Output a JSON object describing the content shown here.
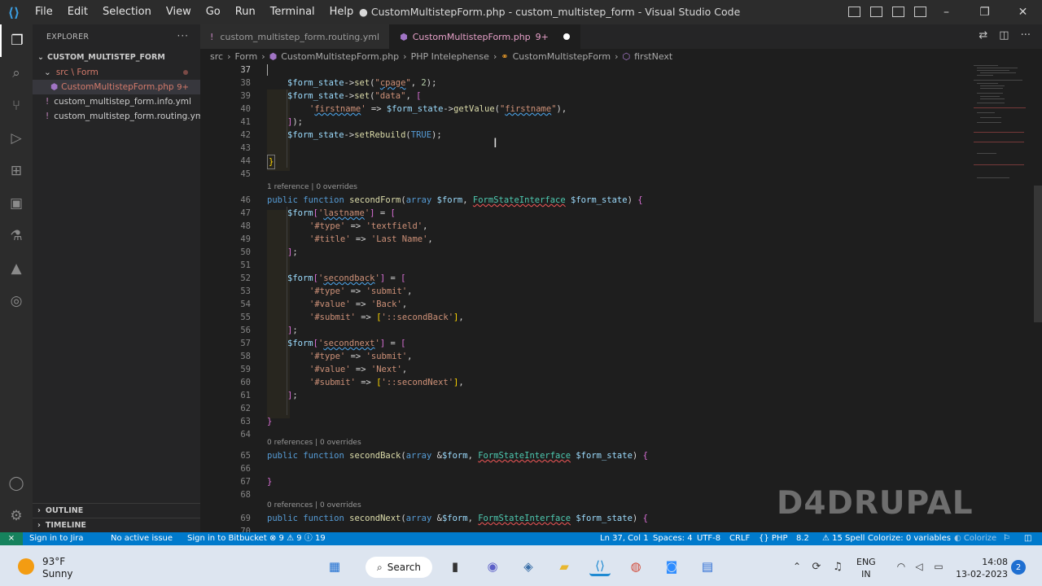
{
  "window": {
    "title": "● CustomMultistepForm.php - custom_multistep_form - Visual Studio Code",
    "menu": [
      "File",
      "Edit",
      "Selection",
      "View",
      "Go",
      "Run",
      "Terminal",
      "Help"
    ],
    "controls": [
      "–",
      "❐",
      "✕"
    ]
  },
  "explorer": {
    "header": "EXPLORER",
    "more": "···",
    "root": "CUSTOM_MULTISTEP_FORM",
    "items": [
      {
        "label": "src \\ Form",
        "badge": ""
      },
      {
        "label": "CustomMultistepForm.php",
        "badge": "9+"
      },
      {
        "label": "custom_multistep_form.info.yml",
        "badge": ""
      },
      {
        "label": "custom_multistep_form.routing.yml",
        "badge": ""
      }
    ],
    "outline": "OUTLINE",
    "timeline": "TIMELINE"
  },
  "tabs": [
    {
      "label": "custom_multistep_form.routing.yml",
      "badge": ""
    },
    {
      "label": "CustomMultistepForm.php",
      "badge": "9+"
    }
  ],
  "breadcrumb": [
    "src",
    "›",
    "Form",
    "›",
    "CustomMultistepForm.php",
    "›",
    "PHP Intelephense",
    "›",
    "CustomMultistepForm",
    "›",
    "firstNext"
  ],
  "code": {
    "lines": [
      {
        "n": "37",
        "t": ""
      },
      {
        "n": "38",
        "t": "$form_state->set(\"cpage\", 2);"
      },
      {
        "n": "39",
        "t": "$form_state->set(\"data\", ["
      },
      {
        "n": "40",
        "t": "'firstname' => $form_state->getValue(\"firstname\"),"
      },
      {
        "n": "41",
        "t": "]);"
      },
      {
        "n": "42",
        "t": "$form_state->setRebuild(TRUE);"
      },
      {
        "n": "43",
        "t": ""
      },
      {
        "n": "44",
        "t": "}"
      },
      {
        "n": "45",
        "t": ""
      },
      {
        "n": "46",
        "t": "public function secondForm(array $form, FormStateInterface $form_state) {"
      },
      {
        "n": "47",
        "t": "$form['lastname'] = ["
      },
      {
        "n": "48",
        "t": "'#type' => 'textfield',"
      },
      {
        "n": "49",
        "t": "'#title' => 'Last Name',"
      },
      {
        "n": "50",
        "t": "];"
      },
      {
        "n": "51",
        "t": ""
      },
      {
        "n": "52",
        "t": "$form['secondback'] = ["
      },
      {
        "n": "53",
        "t": "'#type' => 'submit',"
      },
      {
        "n": "54",
        "t": "'#value' => 'Back',"
      },
      {
        "n": "55",
        "t": "'#submit' => ['::secondBack'],"
      },
      {
        "n": "56",
        "t": "];"
      },
      {
        "n": "57",
        "t": "$form['secondnext'] = ["
      },
      {
        "n": "58",
        "t": "'#type' => 'submit',"
      },
      {
        "n": "59",
        "t": "'#value' => 'Next',"
      },
      {
        "n": "60",
        "t": "'#submit' => ['::secondNext'],"
      },
      {
        "n": "61",
        "t": "];"
      },
      {
        "n": "62",
        "t": ""
      },
      {
        "n": "63",
        "t": "}"
      },
      {
        "n": "64",
        "t": ""
      },
      {
        "n": "65",
        "t": "public function secondBack(array &$form, FormStateInterface $form_state) {"
      },
      {
        "n": "66",
        "t": ""
      },
      {
        "n": "67",
        "t": "}"
      },
      {
        "n": "68",
        "t": ""
      },
      {
        "n": "69",
        "t": "public function secondNext(array &$form, FormStateInterface $form_state) {"
      },
      {
        "n": "70",
        "t": ""
      }
    ],
    "lens": [
      "1 reference | 0 overrides",
      "0 references | 0 overrides",
      "0 references | 0 overrides"
    ]
  },
  "watermark": "D4DRUPAL",
  "status": {
    "remote": "⨯",
    "jira": "Sign in to Jira",
    "issue": "No active issue",
    "bitbucket": "Sign in to Bitbucket",
    "problems": "⊗ 9 ⚠ 9 ⓘ 19",
    "position": "Ln 37, Col 1",
    "spaces": "Spaces: 4",
    "encoding": "UTF-8",
    "eol": "CRLF",
    "language": "PHP",
    "version": "8.2",
    "spell": "15 Spell",
    "colorize": "Colorize: 0 variables",
    "colorize2": "Colorize"
  },
  "taskbar": {
    "temp": "93°F",
    "condition": "Sunny",
    "search": "Search",
    "lang1": "ENG",
    "lang2": "IN",
    "time": "14:08",
    "date": "13-02-2023",
    "notifications": "2"
  },
  "colors": {
    "accent": "#007acc",
    "modified": "#e6a0c8",
    "error": "#e05252"
  }
}
